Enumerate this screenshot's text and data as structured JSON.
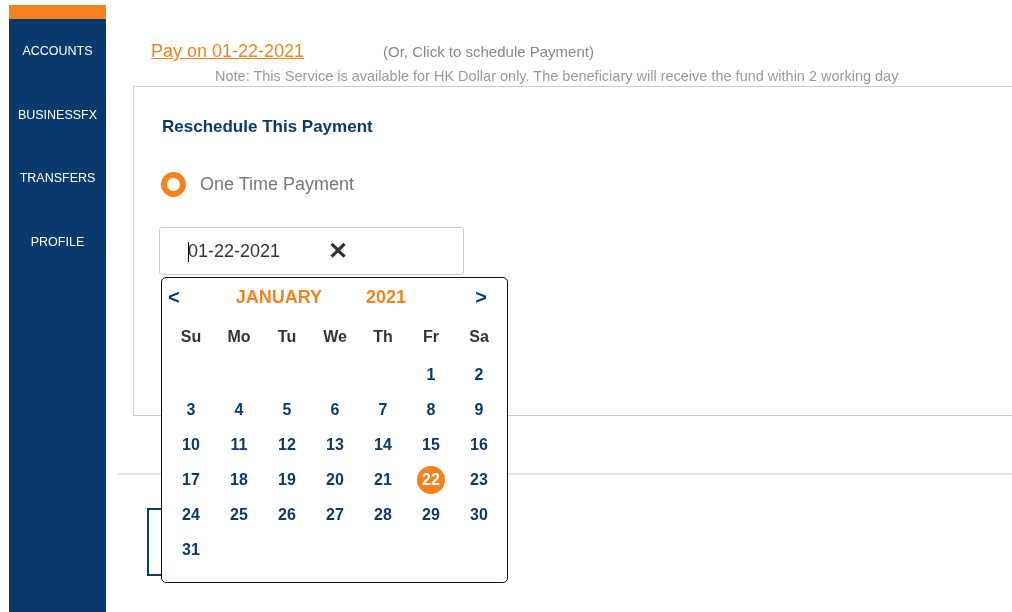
{
  "sidebar": {
    "items": [
      {
        "label": "ACCOUNTS"
      },
      {
        "label": "BUSINESSFX"
      },
      {
        "label": "TRANSFERS"
      },
      {
        "label": "PROFILE"
      }
    ]
  },
  "pay_link": "Pay on 01-22-2021",
  "schedule_hint": "(Or, Click to schedule Payment)",
  "note": "Note: This Service is available for HK Dollar only. The beneficiary will receive the fund within 2 working day",
  "reschedule": {
    "title": "Reschedule This Payment",
    "options": [
      {
        "label": "One Time Payment",
        "selected": true
      }
    ],
    "date_field": {
      "value": "01-22-2021",
      "clear": "✕"
    }
  },
  "calendar": {
    "prev": "<",
    "next": ">",
    "month": "JANUARY",
    "year": "2021",
    "weekdays": [
      "Su",
      "Mo",
      "Tu",
      "We",
      "Th",
      "Fr",
      "Sa"
    ],
    "weeks": [
      {
        "kind": "first",
        "days": [
          {
            "day": "1",
            "selected": false
          },
          {
            "day": "2",
            "selected": false
          }
        ]
      },
      {
        "kind": "full",
        "days": [
          {
            "day": "3",
            "selected": false
          },
          {
            "day": "4",
            "selected": false
          },
          {
            "day": "5",
            "selected": false
          },
          {
            "day": "6",
            "selected": false
          },
          {
            "day": "7",
            "selected": false
          },
          {
            "day": "8",
            "selected": false
          },
          {
            "day": "9",
            "selected": false
          }
        ]
      },
      {
        "kind": "full",
        "days": [
          {
            "day": "10",
            "selected": false
          },
          {
            "day": "11",
            "selected": false
          },
          {
            "day": "12",
            "selected": false
          },
          {
            "day": "13",
            "selected": false
          },
          {
            "day": "14",
            "selected": false
          },
          {
            "day": "15",
            "selected": false
          },
          {
            "day": "16",
            "selected": false
          }
        ]
      },
      {
        "kind": "full",
        "days": [
          {
            "day": "17",
            "selected": false
          },
          {
            "day": "18",
            "selected": false
          },
          {
            "day": "19",
            "selected": false
          },
          {
            "day": "20",
            "selected": false
          },
          {
            "day": "21",
            "selected": false
          },
          {
            "day": "22",
            "selected": true
          },
          {
            "day": "23",
            "selected": false
          }
        ]
      },
      {
        "kind": "full",
        "days": [
          {
            "day": "24",
            "selected": false
          },
          {
            "day": "25",
            "selected": false
          },
          {
            "day": "26",
            "selected": false
          },
          {
            "day": "27",
            "selected": false
          },
          {
            "day": "28",
            "selected": false
          },
          {
            "day": "29",
            "selected": false
          },
          {
            "day": "30",
            "selected": false
          }
        ]
      },
      {
        "kind": "last",
        "days": [
          {
            "day": "31",
            "selected": false
          }
        ]
      }
    ]
  }
}
